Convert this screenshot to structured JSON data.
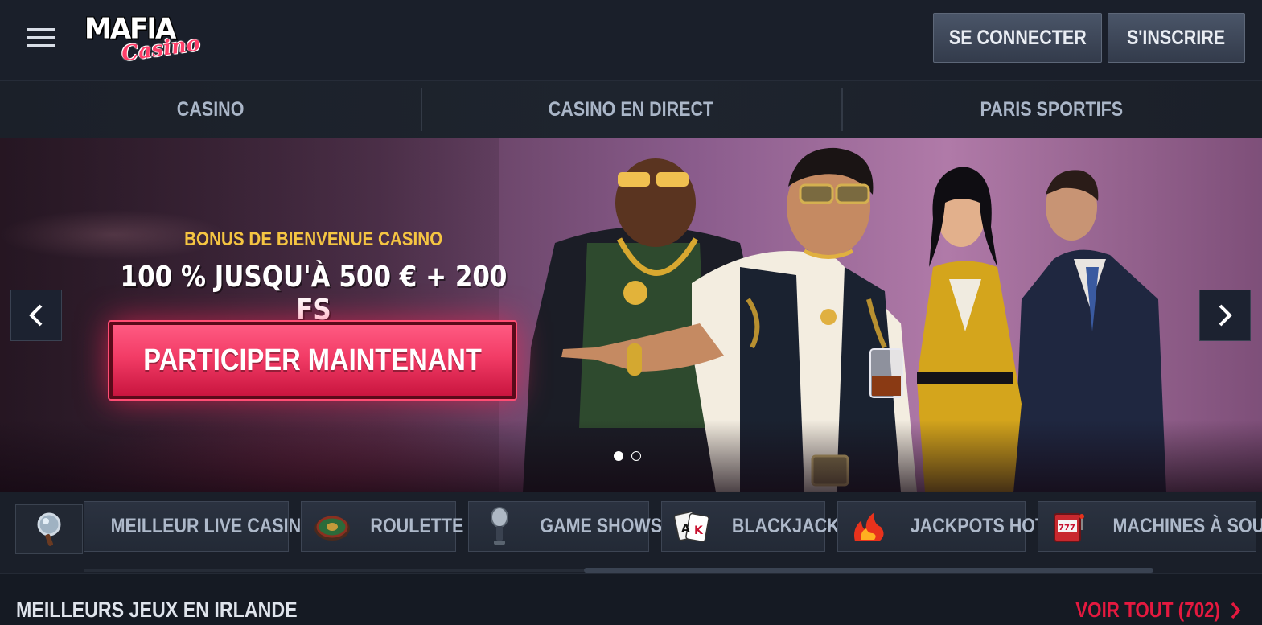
{
  "header": {
    "login_label": "SE CONNECTER",
    "signup_label": "S'INSCRIRE",
    "logo_word": "MAFIA",
    "logo_script": "Casino"
  },
  "nav": {
    "items": [
      {
        "label": "CASINO"
      },
      {
        "label": "CASINO EN DIRECT"
      },
      {
        "label": "PARIS SPORTIFS"
      }
    ]
  },
  "hero": {
    "bonus_label": "BONUS DE BIENVENUE CASINO",
    "bonus_amount": "100 % JUSQU'À 500 € + 200 FS",
    "cta_label": "PARTICIPER MAINTENANT",
    "slides": 2,
    "active_slide": 1
  },
  "categories": {
    "items": [
      {
        "label": "MEILLEUR LIVE CASINO",
        "icon": "magnifier-icon"
      },
      {
        "label": "ROULETTE",
        "icon": "roulette-icon"
      },
      {
        "label": "GAME SHOWS",
        "icon": "microphone-icon"
      },
      {
        "label": "BLACKJACK",
        "icon": "playing-cards-icon"
      },
      {
        "label": "JACKPOTS HOT",
        "icon": "flame-icon"
      },
      {
        "label": "MACHINES À SOUS",
        "icon": "slot-machine-icon"
      }
    ]
  },
  "section": {
    "title": "MEILLEURS JEUX EN IRLANDE",
    "see_all": "VOIR TOUT (702)"
  },
  "colors": {
    "background": "#151a24",
    "accent": "#e4193f",
    "cta": "#f23c66",
    "gold": "#f5c542"
  }
}
